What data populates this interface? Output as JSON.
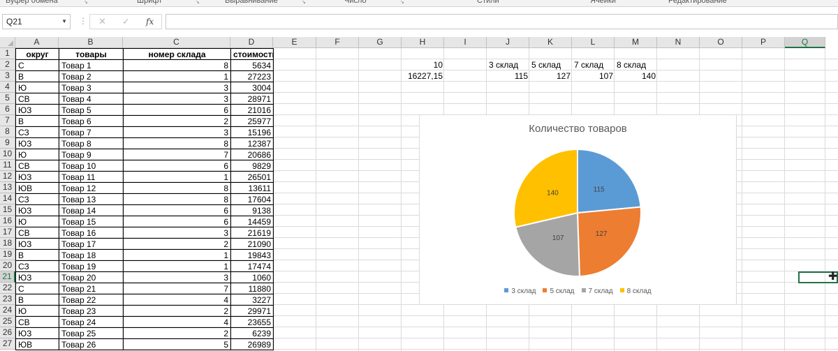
{
  "ribbon": {
    "groups": [
      {
        "label": "Буфер обмена",
        "x": 8
      },
      {
        "label": "Шрифт",
        "x": 196
      },
      {
        "label": "Выравнивание",
        "x": 322
      },
      {
        "label": "Число",
        "x": 493
      },
      {
        "label": "Стили",
        "x": 683
      },
      {
        "label": "Ячейки",
        "x": 845
      },
      {
        "label": "Редактирование",
        "x": 957
      }
    ]
  },
  "formula_bar": {
    "name_box": "Q21",
    "cancel_icon": "✕",
    "enter_icon": "✓",
    "fx_label": "fx",
    "formula": ""
  },
  "columns": [
    "A",
    "B",
    "C",
    "D",
    "E",
    "F",
    "G",
    "H",
    "I",
    "J",
    "K",
    "L",
    "M",
    "N",
    "O",
    "P",
    "Q"
  ],
  "selected_column": "Q",
  "selected_row": 21,
  "table": {
    "headers": [
      "округ",
      "товары",
      "номер склада",
      "стоимость (руб.)"
    ],
    "rows": [
      [
        "С",
        "Товар 1",
        "8",
        "5634"
      ],
      [
        "В",
        "Товар 2",
        "1",
        "27223"
      ],
      [
        "Ю",
        "Товар 3",
        "3",
        "3004"
      ],
      [
        "СВ",
        "Товар 4",
        "3",
        "28971"
      ],
      [
        "ЮЗ",
        "Товар 5",
        "6",
        "21016"
      ],
      [
        "В",
        "Товар 6",
        "2",
        "25977"
      ],
      [
        "СЗ",
        "Товар 7",
        "3",
        "15196"
      ],
      [
        "ЮЗ",
        "Товар 8",
        "8",
        "12387"
      ],
      [
        "Ю",
        "Товар 9",
        "7",
        "20686"
      ],
      [
        "СВ",
        "Товар 10",
        "6",
        "9829"
      ],
      [
        "ЮЗ",
        "Товар 11",
        "1",
        "26501"
      ],
      [
        "ЮВ",
        "Товар 12",
        "8",
        "13611"
      ],
      [
        "СЗ",
        "Товар 13",
        "8",
        "17604"
      ],
      [
        "ЮЗ",
        "Товар 14",
        "6",
        "9138"
      ],
      [
        "Ю",
        "Товар 15",
        "6",
        "14459"
      ],
      [
        "СВ",
        "Товар 16",
        "3",
        "21619"
      ],
      [
        "ЮЗ",
        "Товар 17",
        "2",
        "21090"
      ],
      [
        "В",
        "Товар 18",
        "1",
        "19843"
      ],
      [
        "СЗ",
        "Товар 19",
        "1",
        "17474"
      ],
      [
        "ЮЗ",
        "Товар 20",
        "3",
        "1060"
      ],
      [
        "С",
        "Товар 21",
        "7",
        "11880"
      ],
      [
        "В",
        "Товар 22",
        "4",
        "3227"
      ],
      [
        "Ю",
        "Товар 23",
        "2",
        "29971"
      ],
      [
        "СВ",
        "Товар 24",
        "4",
        "23655"
      ],
      [
        "ЮЗ",
        "Товар 25",
        "2",
        "6239"
      ],
      [
        "ЮВ",
        "Товар 26",
        "5",
        "26989"
      ]
    ]
  },
  "side_cells": {
    "h2": "10",
    "h3": "16227,15",
    "j2": "3 склад",
    "k2": "5 склад",
    "l2": "7 склад",
    "m2": "8 склад",
    "j3": "115",
    "k3": "127",
    "l3": "107",
    "m3": "140"
  },
  "colors": {
    "excel_green": "#217346",
    "series": [
      "#5b9bd5",
      "#ed7d31",
      "#a5a5a5",
      "#ffc000"
    ]
  },
  "chart_data": {
    "type": "pie",
    "title": "Количество товаров",
    "categories": [
      "3 склад",
      "5 склад",
      "7 склад",
      "8 склад"
    ],
    "values": [
      115,
      127,
      107,
      140
    ],
    "data_labels": [
      "115",
      "127",
      "107",
      "140"
    ],
    "legend": "bottom"
  }
}
